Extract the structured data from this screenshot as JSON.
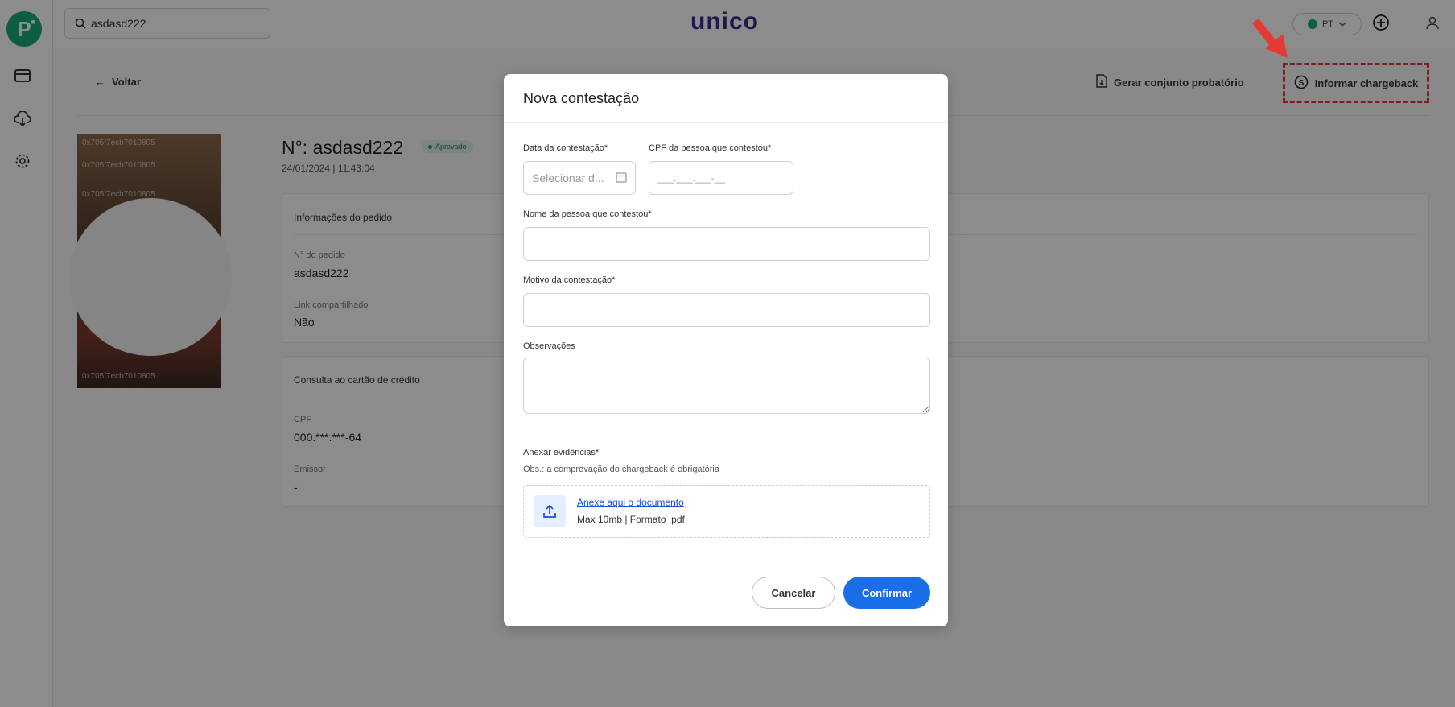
{
  "topbar": {
    "search_value": "asdasd222",
    "brand": "unico",
    "lang": "PT"
  },
  "actions": {
    "back": "Voltar",
    "generate": "Gerar conjunto probatório",
    "chargeback": "Informar chargeback"
  },
  "photo": {
    "watermark": "0x705f7ecb7010805"
  },
  "order": {
    "title": "N°: asdasd222",
    "status": "Aprovado",
    "datetime": "24/01/2024 | 11:43:04"
  },
  "info_card": {
    "title": "Informações do pedido",
    "order_number_label": "N° do pedido",
    "order_number_value": "asdasd222",
    "shared_link_label": "Link compartilhado",
    "shared_link_value": "Não"
  },
  "credit_card": {
    "title": "Consulta ao cartão de crédito",
    "cpf_label": "CPF",
    "cpf_value": "000.***.***-64",
    "issuer_label": "Emissor",
    "issuer_value": "-"
  },
  "modal": {
    "title": "Nova contestação",
    "date_label": "Data da contestação*",
    "date_placeholder": "Selecionar d...",
    "cpf_label": "CPF da pessoa que contestou*",
    "cpf_placeholder": "___.___.___-__",
    "name_label": "Nome da pessoa que contestou*",
    "reason_label": "Motivo da contestação*",
    "notes_label": "Observações",
    "attach_label": "Anexar evidências*",
    "attach_note": "Obs.: a comprovação do chargeback é obrigatória",
    "upload_link": "Anexe aqui o documento",
    "upload_note": "Max 10mb | Formato .pdf",
    "cancel": "Cancelar",
    "confirm": "Confirmar"
  }
}
